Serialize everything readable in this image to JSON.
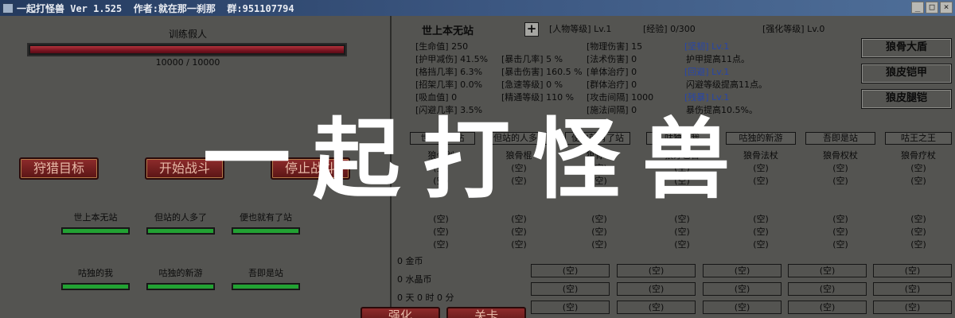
{
  "window": {
    "title": "一起打怪兽 Ver 1.525  作者:就在那一刹那  群:951107794",
    "buttons": [
      "_",
      "□",
      "×"
    ]
  },
  "left": {
    "train_label": "训练假人",
    "hp_fill": 1.0,
    "hp_text": "10000 / 10000",
    "buttons": [
      "狩猎目标",
      "开始战斗",
      "停止战斗"
    ],
    "members": [
      {
        "name": "世上本无站",
        "level": 1.0
      },
      {
        "name": "但站的人多了",
        "level": 1.0
      },
      {
        "name": "便也就有了站",
        "level": 1.0
      },
      {
        "name": "咕独的我",
        "level": 1.0
      },
      {
        "name": "咕独的新游",
        "level": 1.0
      },
      {
        "name": "吾即是站",
        "level": 1.0
      }
    ]
  },
  "right": {
    "char_name": "世上本无站",
    "plus": "+",
    "level": "[人物等级] Lv.1",
    "exp": "[经验] 0/300",
    "enhance": "[强化等级] Lv.0",
    "stats_col1": [
      "[生命值] 250",
      "[护甲减伤] 41.5%",
      "[格挡几率] 6.3%",
      "[招架几率] 0.0%",
      "[吸血值] 0",
      "[闪避几率] 3.5%"
    ],
    "stats_col2": [
      "",
      "[暴击几率] 5 %",
      "[暴击伤害] 160.5 %",
      "[急速等级] 0 %",
      "[精通等级] 110 %",
      ""
    ],
    "stats_col3": [
      "[物理伤害] 15",
      "[法术伤害] 0",
      "[单体治疗] 0",
      "[群体治疗] 0",
      "[攻击间隔] 1000",
      "[施法间隔] 0"
    ],
    "skills": [
      {
        "name": "[坚韧] Lv.1",
        "desc": "护甲提高11点。"
      },
      {
        "name": "[回避] Lv.1",
        "desc": "闪避等级提高11点。"
      },
      {
        "name": "[残暴] Lv.1",
        "desc": "暴伤提高10.5%。"
      }
    ],
    "equip": [
      "狼骨大盾",
      "狼皮铠甲",
      "狼皮腿铠"
    ],
    "columns": [
      {
        "head": "世上本无站",
        "item": "狼骨剑"
      },
      {
        "head": "但站的人多了",
        "item": "狼骨棍"
      },
      {
        "head": "便也就有了站",
        "item": "狼骨弓"
      },
      {
        "head": "咕独的我",
        "item": "狼牙匕首"
      },
      {
        "head": "咕独的新游",
        "item": "狼骨法杖"
      },
      {
        "head": "吾即是站",
        "item": "狼骨权杖"
      },
      {
        "head": "咕王之王",
        "item": "狼骨疗杖"
      }
    ],
    "empty": "(空)",
    "gold": "0 金币",
    "crystal": "0 水晶币",
    "time": "0 天  0 时  0 分",
    "bottom_buttons": [
      "强化",
      "关卡"
    ]
  },
  "overlay_title": "一起打怪兽"
}
